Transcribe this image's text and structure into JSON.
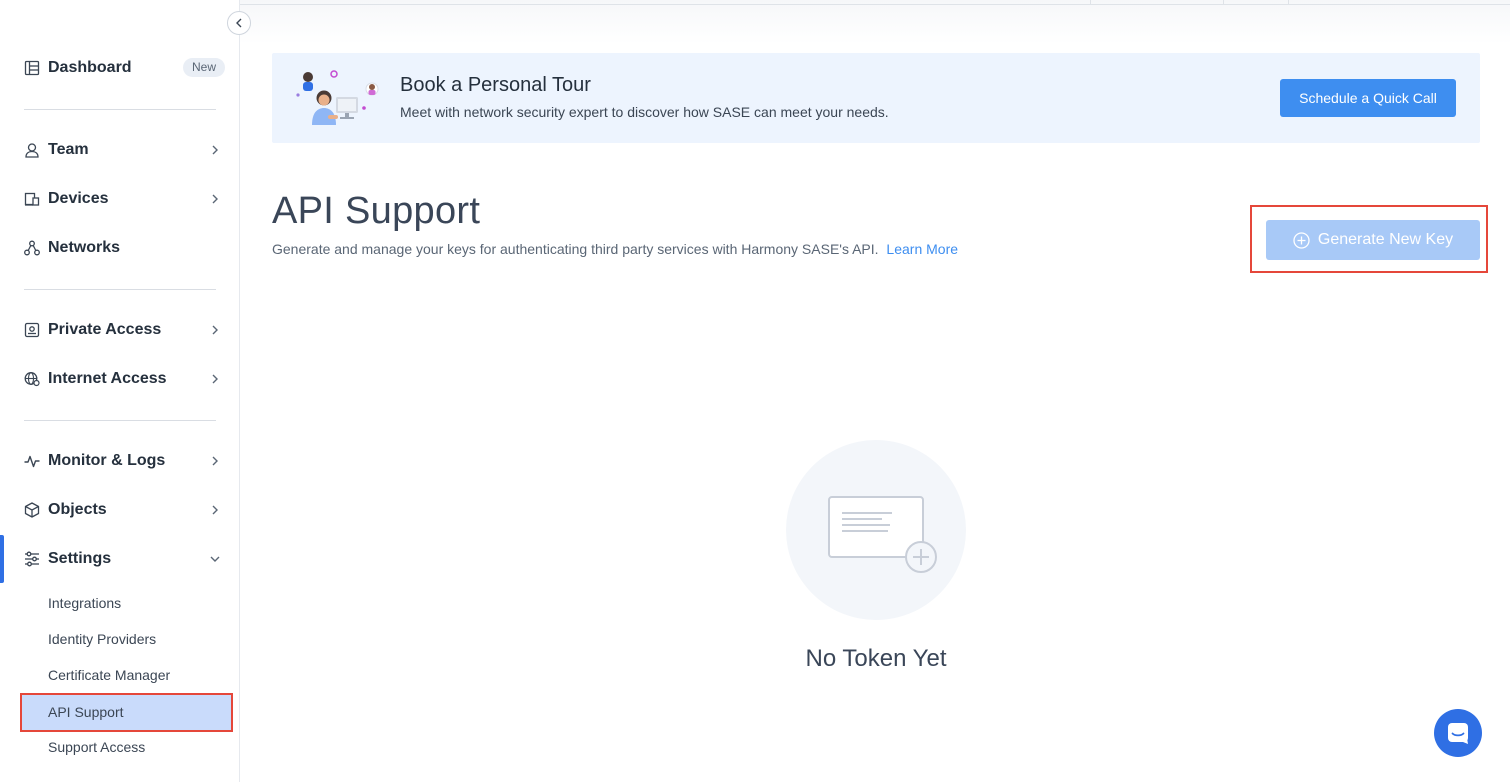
{
  "sidebar": {
    "items": [
      {
        "label": "Dashboard",
        "badge": "New",
        "icon": "dashboard-icon"
      },
      {
        "label": "Team",
        "icon": "user-icon"
      },
      {
        "label": "Devices",
        "icon": "devices-icon"
      },
      {
        "label": "Networks",
        "icon": "network-icon"
      },
      {
        "label": "Private Access",
        "icon": "private-access-icon"
      },
      {
        "label": "Internet Access",
        "icon": "globe-icon"
      },
      {
        "label": "Monitor & Logs",
        "icon": "pulse-icon"
      },
      {
        "label": "Objects",
        "icon": "cube-icon"
      },
      {
        "label": "Settings",
        "icon": "sliders-icon"
      }
    ],
    "settings_sub": [
      {
        "label": "Integrations"
      },
      {
        "label": "Identity Providers"
      },
      {
        "label": "Certificate Manager"
      },
      {
        "label": "API Support"
      },
      {
        "label": "Support Access"
      }
    ]
  },
  "banner": {
    "title": "Book a Personal Tour",
    "subtitle": "Meet with network security expert to discover how SASE can meet your needs.",
    "button": "Schedule a Quick Call"
  },
  "page": {
    "title": "API Support",
    "description": "Generate and manage your keys for authenticating third party services with Harmony SASE's API.",
    "learn_more": "Learn More",
    "generate_button": "Generate New Key"
  },
  "empty_state": {
    "title": "No Token Yet"
  },
  "colors": {
    "accent": "#3e8ef0",
    "active_bg": "#c9dbfb",
    "highlight_outline": "#e5473a",
    "disabled_button": "#a8c9f7"
  }
}
